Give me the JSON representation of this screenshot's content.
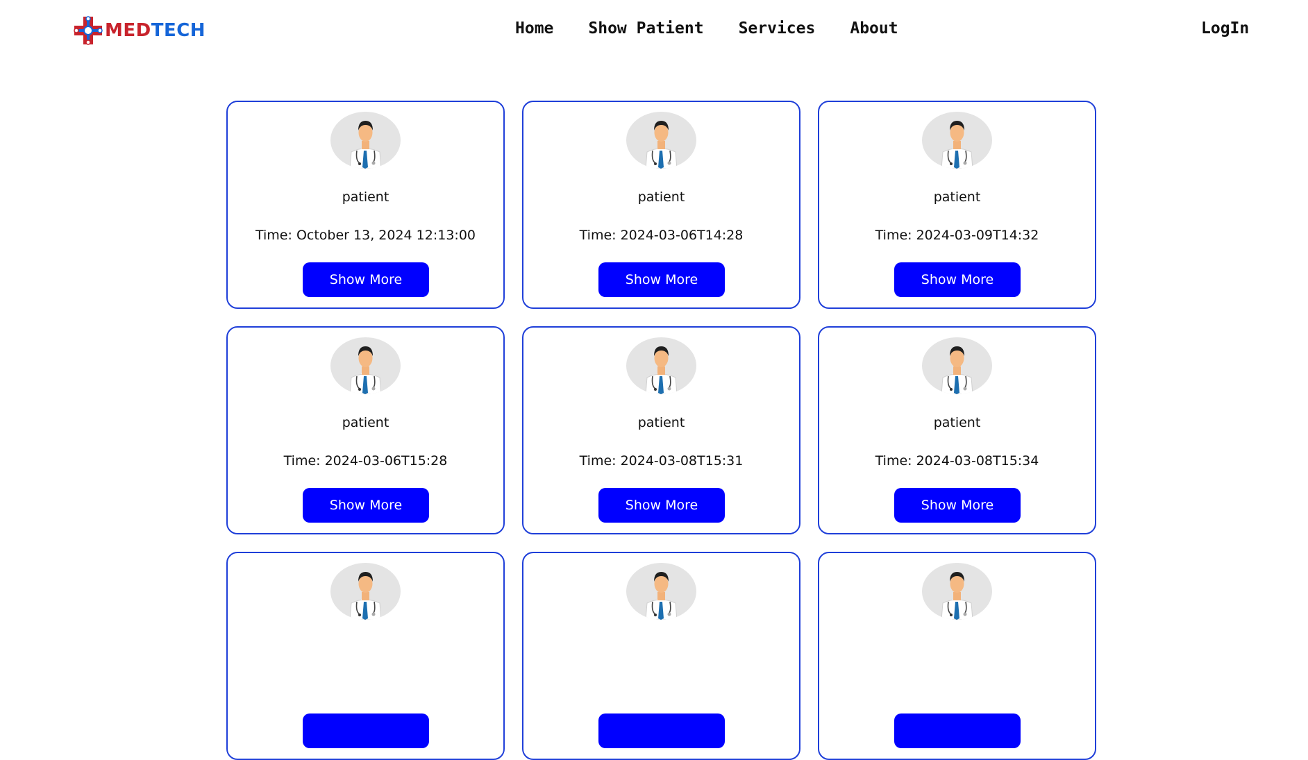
{
  "header": {
    "logo": {
      "part1": "MED",
      "part2": "TECH"
    },
    "nav": [
      "Home",
      "Show Patient",
      "Services",
      "About"
    ],
    "login_label": "LogIn"
  },
  "cards": [
    {
      "name": "patient",
      "time": "Time: October 13, 2024 12:13:00",
      "button": "Show More"
    },
    {
      "name": "patient",
      "time": "Time: 2024-03-06T14:28",
      "button": "Show More"
    },
    {
      "name": "patient",
      "time": "Time: 2024-03-09T14:32",
      "button": "Show More"
    },
    {
      "name": "patient",
      "time": "Time: 2024-03-06T15:28",
      "button": "Show More"
    },
    {
      "name": "patient",
      "time": "Time: 2024-03-08T15:31",
      "button": "Show More"
    },
    {
      "name": "patient",
      "time": "Time: 2024-03-08T15:34",
      "button": "Show More"
    },
    {
      "name": "",
      "time": "",
      "button": ""
    },
    {
      "name": "",
      "time": "",
      "button": ""
    },
    {
      "name": "",
      "time": "",
      "button": ""
    }
  ],
  "icons": {
    "logo": "medical-cross-logo-icon",
    "avatar": "doctor-avatar-icon"
  },
  "colors": {
    "accent": "#0000ff",
    "card_border": "#1f3fd9",
    "logo_red": "#c8232c",
    "logo_blue": "#1565d8"
  }
}
